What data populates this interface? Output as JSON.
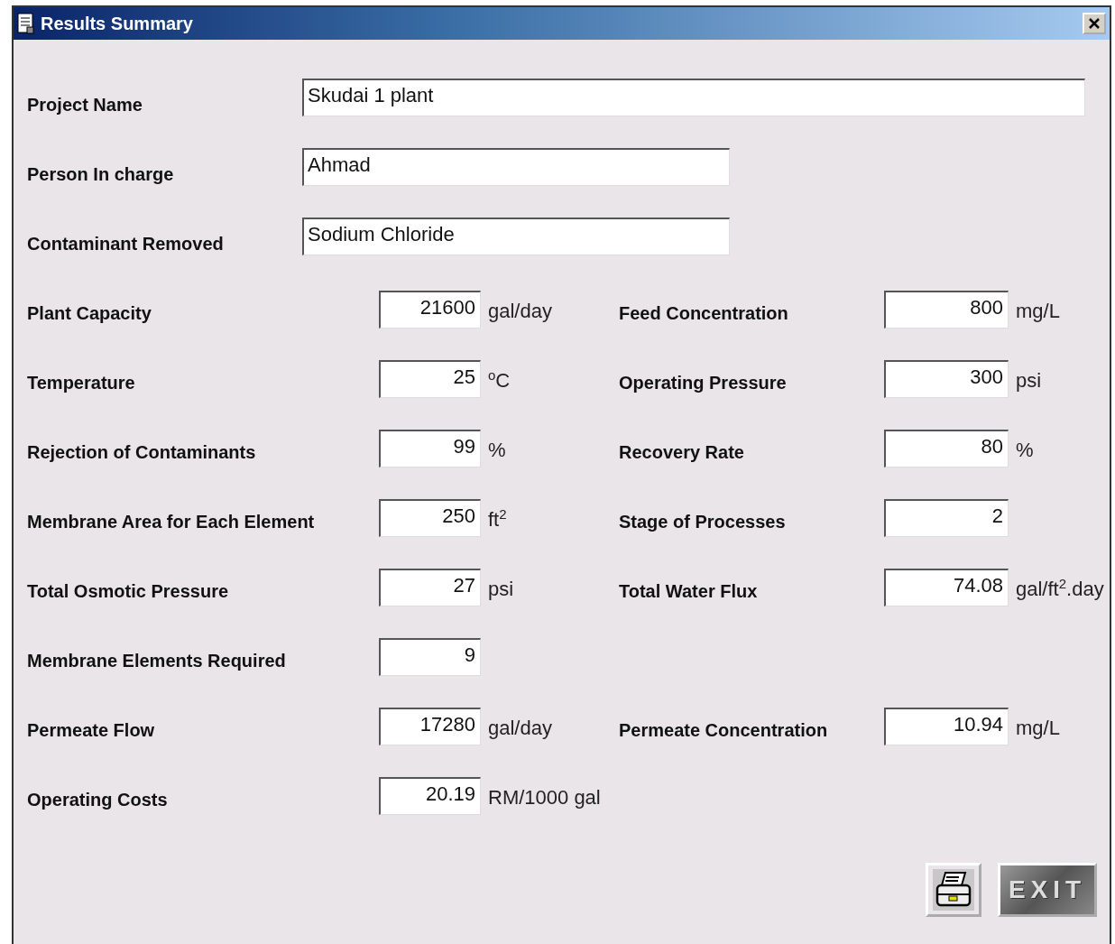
{
  "window": {
    "title": "Results Summary"
  },
  "text_fields": [
    {
      "label": "Project Name",
      "value": "Skudai 1 plant",
      "kind": "wide"
    },
    {
      "label": "Person In charge",
      "value": "Ahmad",
      "kind": "medium"
    },
    {
      "label": "Contaminant Removed",
      "value": "Sodium Chloride",
      "kind": "medium"
    }
  ],
  "rows": [
    {
      "left": {
        "label": "Plant Capacity",
        "value": "21600",
        "unit": "gal/day"
      },
      "right": {
        "label": "Feed Concentration",
        "value": "800",
        "unit": "mg/L"
      }
    },
    {
      "left": {
        "label": "Temperature",
        "value": "25",
        "unit": "$^{o}$C"
      },
      "right": {
        "label": "Operating Pressure",
        "value": "300",
        "unit": "psi"
      }
    },
    {
      "left": {
        "label": "Rejection of Contaminants",
        "value": "99",
        "unit": "%"
      },
      "right": {
        "label": "Recovery Rate",
        "value": "80",
        "unit": "%"
      }
    },
    {
      "left": {
        "label": "Membrane Area for Each Element",
        "value": "250",
        "unit": "ft$^{2}$"
      },
      "right": {
        "label": "Stage of Processes",
        "value": "2"
      }
    },
    {
      "left": {
        "label": "Total Osmotic Pressure",
        "value": "27",
        "unit": "psi"
      },
      "right": {
        "label": "Total Water Flux",
        "value": "74.08",
        "unit": "gal/ft$^{2}$.day"
      }
    },
    {
      "left": {
        "label": "Membrane Elements Required",
        "value": "9"
      }
    },
    {
      "left": {
        "label": "Permeate Flow",
        "value": "17280",
        "unit": "gal/day"
      },
      "right": {
        "label": "Permeate Concentration",
        "value": "10.94",
        "unit": "mg/L"
      }
    },
    {
      "left": {
        "label": "Operating Costs",
        "value": "20.19",
        "unit": "RM/1000 gal"
      }
    }
  ],
  "buttons": {
    "exit": "EXIT"
  }
}
